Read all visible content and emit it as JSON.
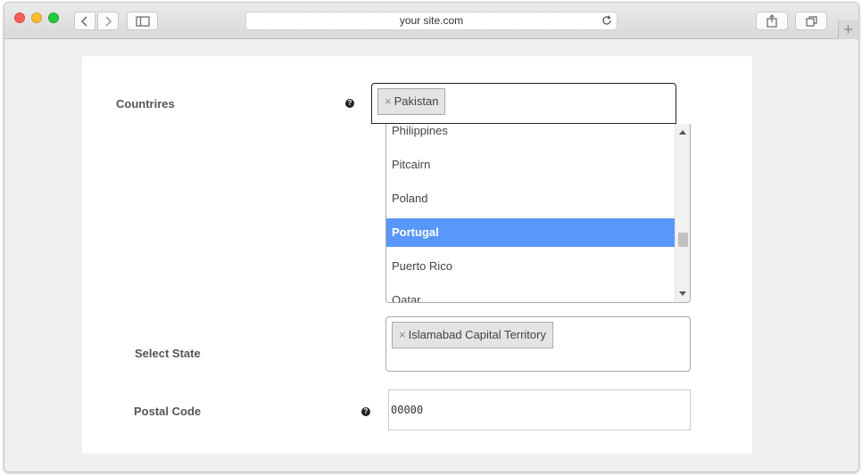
{
  "browser": {
    "address": "your site.com",
    "newtab_symbol": "+"
  },
  "form": {
    "countries": {
      "label": "Countrires",
      "help": "?",
      "selected_tags": [
        "Pakistan"
      ],
      "options": [
        "Philippines",
        "Pitcairn",
        "Poland",
        "Portugal",
        "Puerto Rico",
        "Qatar"
      ],
      "highlighted": "Portugal"
    },
    "state": {
      "label": "Select State",
      "selected_tags": [
        "Islamabad Capital Territory"
      ]
    },
    "postal": {
      "label": "Postal Code",
      "help": "?",
      "value": "00000"
    },
    "tag_remove_symbol": "×"
  },
  "colors": {
    "highlight": "#5897fb",
    "tag_bg": "#e4e4e4"
  }
}
